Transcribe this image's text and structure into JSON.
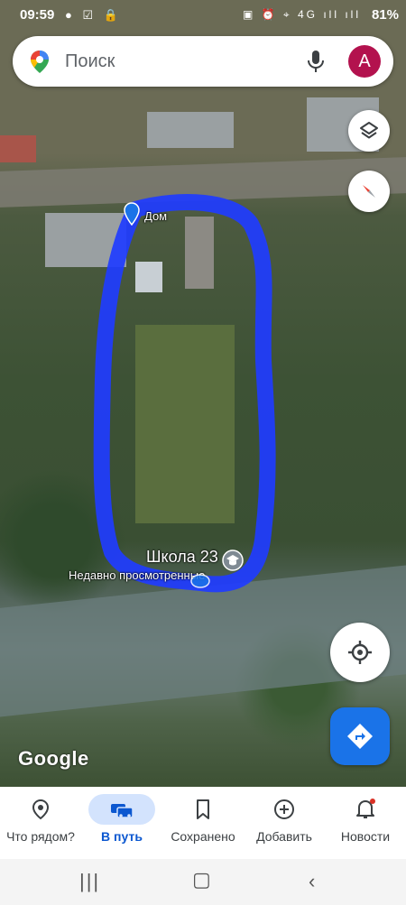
{
  "status_bar": {
    "time": "09:59",
    "left_icons": "● ☑ 🔒",
    "right_icons": "▣ ⏰ ⌖ 4G ıll ıll",
    "battery": "81%"
  },
  "search": {
    "placeholder": "Поиск",
    "avatar_letter": "A"
  },
  "map": {
    "place_home": "Дом",
    "place_school": "Школа 23",
    "recent_label": "Недавно просмотренные",
    "attribution": "Google",
    "drawn_loop_color": "#1f3cff"
  },
  "nav": {
    "items": [
      {
        "label": "Что рядом?",
        "icon": "location-pin-icon"
      },
      {
        "label": "В путь",
        "icon": "car-icon"
      },
      {
        "label": "Сохранено",
        "icon": "bookmark-icon"
      },
      {
        "label": "Добавить",
        "icon": "add-circle-icon"
      },
      {
        "label": "Новости",
        "icon": "bell-icon"
      }
    ],
    "active_index": 1,
    "accent": "#0b57d0"
  }
}
